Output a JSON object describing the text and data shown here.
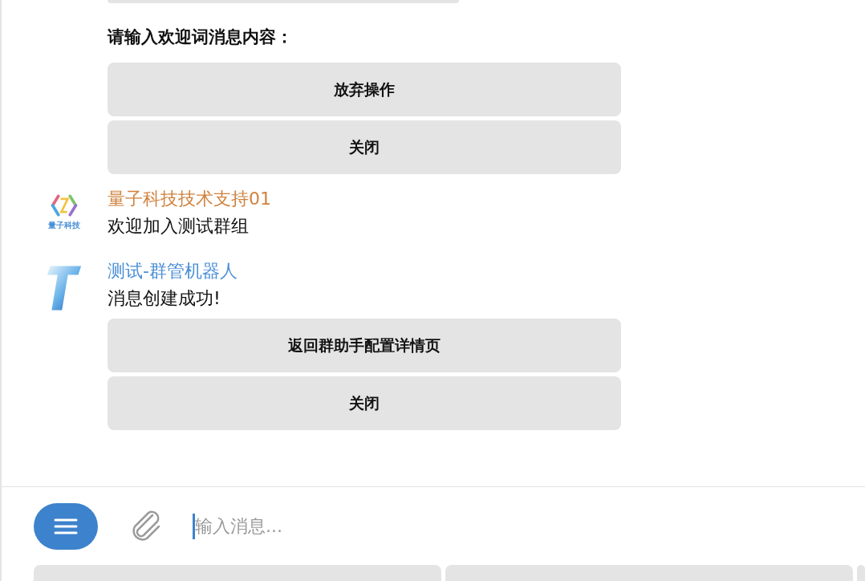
{
  "prompt": "请输入欢迎词消息内容：",
  "prompt_buttons": [
    "放弃操作",
    "关闭"
  ],
  "messages": [
    {
      "kind": "logo",
      "avatar_label": "量子科技",
      "sender": "量子科技技术支持01",
      "color": "#d0823e",
      "text": "欢迎加入测试群组"
    },
    {
      "kind": "t-logo",
      "sender": "测试-群管机器人",
      "color": "#4a8fd6",
      "text": "消息创建成功!",
      "buttons": [
        "返回群助手配置详情页",
        "关闭"
      ]
    }
  ],
  "composer": {
    "placeholder": "输入消息..."
  }
}
